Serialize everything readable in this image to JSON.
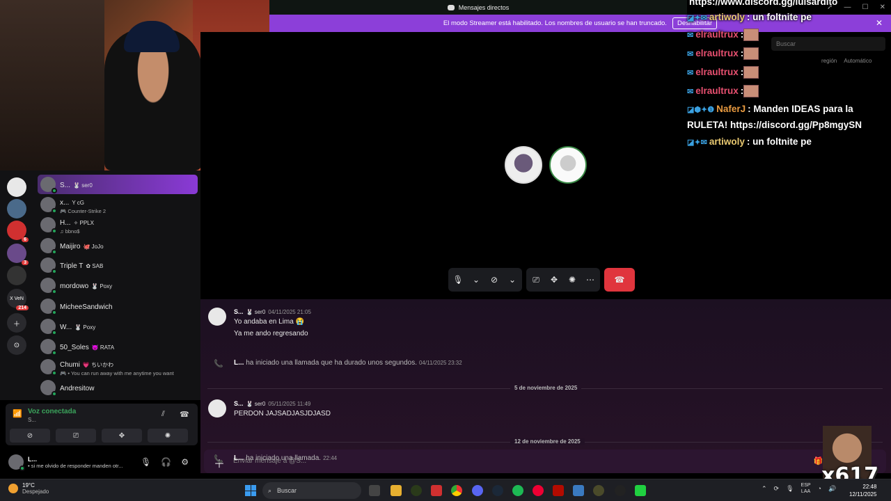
{
  "window": {
    "title": "Mensajes directos"
  },
  "banner": {
    "text": "El modo Streamer está habilitado. Los nombres de usuario se han truncado.",
    "button": "Deshabilitar"
  },
  "chat": {
    "lines": [
      {
        "badges": "",
        "user": "https://www.discord.gg/luisardito",
        "text": "",
        "color": "#ffffff"
      },
      {
        "badges": "◪✦✉",
        "user": "artiwoly",
        "text": ": un foltnite pe",
        "color": "#e8c870"
      },
      {
        "badges": "✉",
        "user": "elraultrux",
        "text": ":",
        "color": "#e85070"
      },
      {
        "badges": "✉",
        "user": "elraultrux",
        "text": ":",
        "color": "#e85070"
      },
      {
        "badges": "✉",
        "user": "elraultrux",
        "text": ":",
        "color": "#e85070"
      },
      {
        "badges": "✉",
        "user": "elraultrux",
        "text": ":",
        "color": "#e85070"
      },
      {
        "badges": "◪⬢✦❶",
        "user": "NaferJ",
        "text": ": Manden IDEAS para la RULETA! https://discord.gg/Pp8mgySN",
        "color": "#e89a40"
      },
      {
        "badges": "◪✦✉",
        "user": "artiwoly",
        "text": ": un foltnite pe",
        "color": "#e8c870"
      }
    ],
    "search_placeholder": "Buscar",
    "region_label": "región",
    "region_value": "Automático"
  },
  "servers": [
    {
      "name": "server-1",
      "badge": ""
    },
    {
      "name": "server-2",
      "badge": ""
    },
    {
      "name": "server-3",
      "badge": "6"
    },
    {
      "name": "server-4",
      "badge": "3"
    },
    {
      "name": "server-5",
      "badge": ""
    },
    {
      "name": "server-6",
      "badge": "214",
      "label": "X VeN"
    }
  ],
  "dms": [
    {
      "name": "S...",
      "tag": "🐰 ser0",
      "sub": ""
    },
    {
      "name": "x...",
      "tag": "Y cG",
      "sub": "🎮 Counter-Strike 2"
    },
    {
      "name": "H...",
      "tag": "✧ PPLX",
      "sub": "♫ bbno$"
    },
    {
      "name": "Maijiro",
      "tag": "🐙 JoJo",
      "sub": ""
    },
    {
      "name": "Triple T",
      "tag": "✿ SAB",
      "sub": ""
    },
    {
      "name": "mordowo",
      "tag": "🐰 Poxy",
      "sub": ""
    },
    {
      "name": "MicheeSandwich",
      "tag": "",
      "sub": ""
    },
    {
      "name": "W...",
      "tag": "🐰 Poxy",
      "sub": ""
    },
    {
      "name": "50_Soles",
      "tag": "😈 RATA",
      "sub": ""
    },
    {
      "name": "Chumi",
      "tag": "💗 ちいかわ",
      "sub": "🎮 • You can run away with me anytime you want"
    },
    {
      "name": "Andresitow",
      "tag": "",
      "sub": ""
    }
  ],
  "voice": {
    "status": "Voz conectada",
    "channel": "S..."
  },
  "user": {
    "name": "L...",
    "status": "• si me olvido de responder manden otr..."
  },
  "messages": [
    {
      "author": "S...",
      "tag": "🐰 ser0",
      "time": "04/11/2025 21:05",
      "lines": [
        "Yo andaba en Lima 😭",
        "Ya me ando regresando"
      ]
    },
    {
      "system": true,
      "author": "L...",
      "text": "ha iniciado una llamada que ha durado unos segundos.",
      "time": "04/11/2025 23:32"
    },
    {
      "divider": "5 de noviembre de 2025"
    },
    {
      "author": "S...",
      "tag": "🐰 ser0",
      "time": "05/11/2025 11:49",
      "lines": [
        "PERDON JAJSADJASJDJASD"
      ]
    },
    {
      "divider": "12 de noviembre de 2025"
    },
    {
      "system": true,
      "author": "L...",
      "text": "ha iniciado una llamada.",
      "time": "22:44"
    }
  ],
  "composer": {
    "placeholder": "Enviar mensaje a @S..."
  },
  "overlay_label": "x617",
  "taskbar": {
    "weather_temp": "19°C",
    "weather_desc": "Despejado",
    "search": "Buscar",
    "lang_1": "ESP",
    "lang_2": "LAA",
    "time": "22:48",
    "date": "12/11/2025"
  }
}
